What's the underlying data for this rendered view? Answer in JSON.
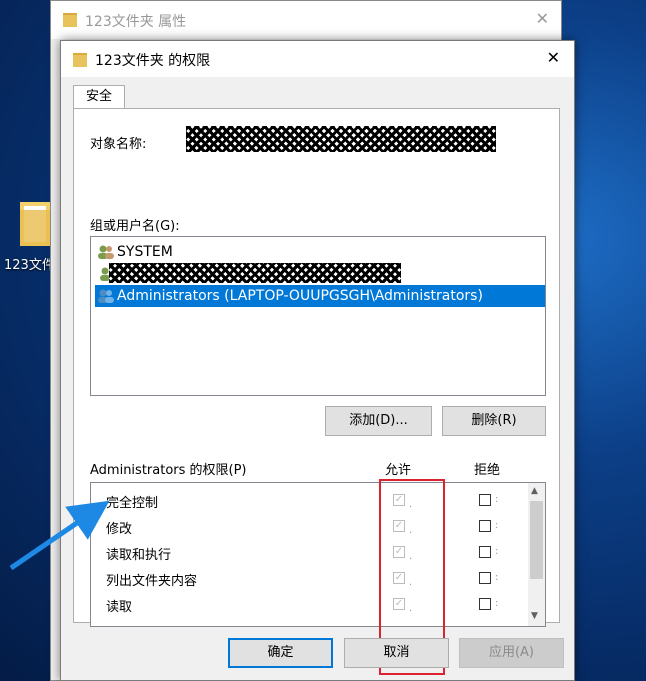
{
  "desktop": {
    "icon_label": "123文件"
  },
  "back_window": {
    "title": "123文件夹 属性"
  },
  "dialog": {
    "title": "123文件夹 的权限",
    "tab": "安全",
    "object_name_label": "对象名称:",
    "group_label": "组或用户名(G):",
    "users": [
      {
        "name": "SYSTEM",
        "selected": false
      },
      {
        "name": "",
        "selected": false,
        "redacted": true
      },
      {
        "name": "Administrators (LAPTOP-OUUPGSGH\\Administrators)",
        "selected": true
      }
    ],
    "add_button": "添加(D)...",
    "remove_button": "删除(R)",
    "perm_title": "Administrators 的权限(P)",
    "allow_label": "允许",
    "deny_label": "拒绝",
    "permissions": [
      {
        "name": "完全控制",
        "allow": true,
        "deny": false
      },
      {
        "name": "修改",
        "allow": true,
        "deny": false
      },
      {
        "name": "读取和执行",
        "allow": true,
        "deny": false
      },
      {
        "name": "列出文件夹内容",
        "allow": true,
        "deny": false
      },
      {
        "name": "读取",
        "allow": true,
        "deny": false
      }
    ],
    "ok_button": "确定",
    "cancel_button": "取消",
    "apply_button": "应用(A)"
  },
  "colors": {
    "selection": "#0078d7",
    "highlight_box": "#d9232e",
    "arrow": "#1e88e5"
  }
}
